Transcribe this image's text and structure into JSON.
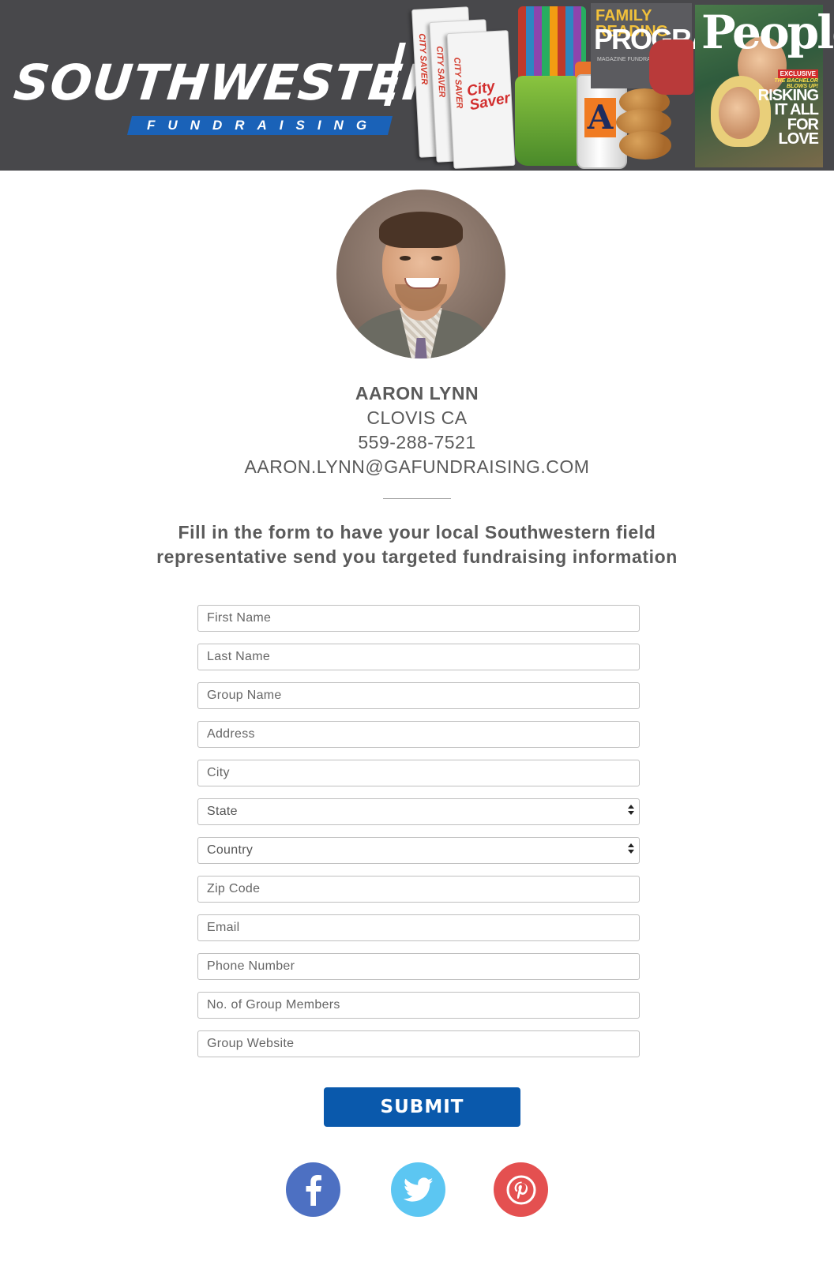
{
  "header": {
    "logo_main": "SOUTHWESTERN",
    "logo_sub": "FUNDRAISING",
    "products": {
      "city_saver_spine": "CITY SAVER",
      "city_saver_title": "City Saver",
      "cup_logo": "A",
      "magazine_frp_line1": "FAMILY READING",
      "magazine_frp_line2": "PROGRAM",
      "magazine_frp_line3": "MAGAZINE FUNDRAISER",
      "people_title": "People",
      "people_exclusive": "EXCLUSIVE",
      "people_bachelor": "THE BACHELOR BLOWS UP!",
      "people_headline": "RISKING IT ALL FOR LOVE"
    }
  },
  "rep": {
    "name": "AARON LYNN",
    "city": "CLOVIS CA",
    "phone": "559-288-7521",
    "email": "AARON.LYNN@GAFUNDRAISING.COM"
  },
  "intro_text": "Fill in the form to have your local Southwestern field representative send you targeted fundraising information",
  "form": {
    "first_name_placeholder": "First Name",
    "last_name_placeholder": "Last Name",
    "group_name_placeholder": "Group Name",
    "address_placeholder": "Address",
    "city_placeholder": "City",
    "state_selected": "State",
    "country_selected": "Country",
    "zip_placeholder": "Zip Code",
    "email_placeholder": "Email",
    "phone_placeholder": "Phone Number",
    "members_placeholder": "No. of Group Members",
    "website_placeholder": "Group Website",
    "submit_label": "SUBMIT"
  },
  "social": [
    {
      "icon": "facebook-icon",
      "color": "#4d70c2"
    },
    {
      "icon": "twitter-icon",
      "color": "#5cc6f2"
    },
    {
      "icon": "pinterest-icon",
      "color": "#e45050"
    }
  ],
  "colors": {
    "header_bg": "#48484b",
    "brand_blue": "#0a59ac",
    "text": "#5a5a5a"
  }
}
